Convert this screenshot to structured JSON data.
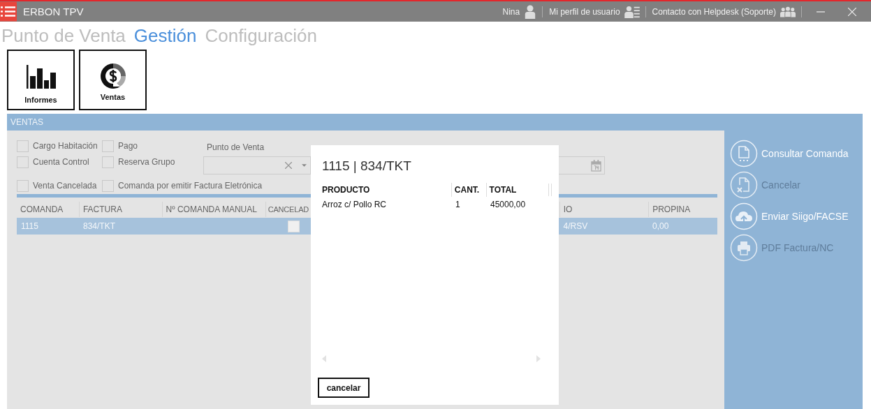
{
  "window": {
    "title": "ERBON TPV"
  },
  "header_links": [
    {
      "label": "Nina",
      "kind": "user"
    },
    {
      "label": "Mi perfil de usuario",
      "kind": "profile"
    },
    {
      "label": "Contacto con Helpdesk (Soporte)",
      "kind": "group"
    }
  ],
  "tabs": [
    {
      "label": "Punto de Venta",
      "selected": false
    },
    {
      "label": "Gestión",
      "selected": true
    },
    {
      "label": "Configuración",
      "selected": false
    }
  ],
  "tiles": [
    {
      "label": "Informes",
      "kind": "chart"
    },
    {
      "label": "Ventas",
      "kind": "money"
    }
  ],
  "panel": {
    "title": "VENTAS",
    "filters": [
      {
        "label": "Cargo Habitación",
        "checked": false
      },
      {
        "label": "Pago",
        "checked": false
      },
      {
        "label": "Cuenta Control",
        "checked": false
      },
      {
        "label": "Reserva Grupo",
        "checked": false
      },
      {
        "label": "Venta Cancelada",
        "checked": false
      },
      {
        "label": "Comanda por emitir Factura Eletrónica",
        "checked": false
      }
    ],
    "punto_de_venta": {
      "label": "Punto de Venta"
    },
    "table": {
      "columns": [
        "COMANDA",
        "FACTURA",
        "Nº COMANDA MANUAL",
        "CANCELAD",
        "IO",
        "PROPINA"
      ],
      "rows": [
        {
          "selected": true,
          "comanda": "1115",
          "factura": "834/TKT",
          "cancelada": false,
          "column_5": "4/RSV",
          "propina": "0,00"
        }
      ]
    }
  },
  "actions": [
    {
      "label": "Consultar Comanda",
      "kind": "document",
      "disabled": false
    },
    {
      "label": "Cancelar",
      "kind": "cancel",
      "disabled": true
    },
    {
      "label": "Enviar Siigo/FACSE",
      "kind": "cloud",
      "disabled": false
    },
    {
      "label": "PDF Factura/NC",
      "kind": "print",
      "disabled": true
    }
  ],
  "modal": {
    "title": "1115 | 834/TKT",
    "columns": [
      "PRODUCTO",
      "CANT.",
      "TOTAL"
    ],
    "rows": [
      {
        "producto": "Arroz c/ Pollo RC",
        "cant": "1",
        "total": "45000,00"
      }
    ],
    "button": "cancelar"
  }
}
